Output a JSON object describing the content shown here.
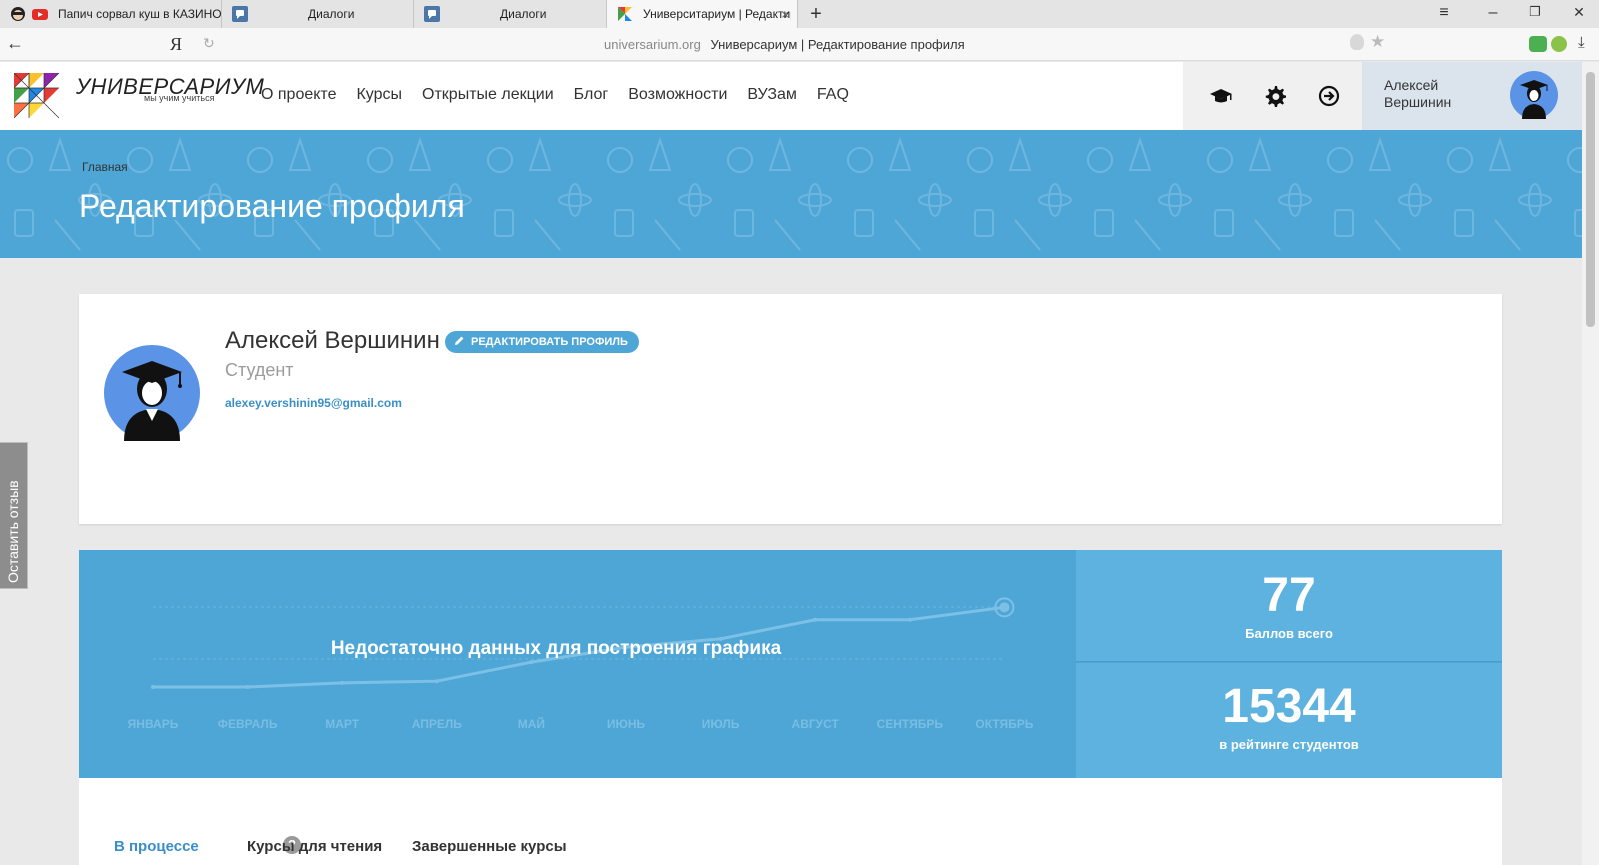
{
  "browser": {
    "tabs": [
      {
        "title": "Папич сорвал куш в КАЗИНО",
        "icon": "youtube-icon"
      },
      {
        "title": "Диалоги",
        "icon": "vk-dialogs-icon"
      },
      {
        "title": "Диалоги",
        "icon": "vk-dialogs-icon"
      },
      {
        "title": "Университариум | Редактирование профиля",
        "icon": "universarium-icon"
      }
    ],
    "tab_close": "×",
    "new_tab": "+",
    "window_controls": {
      "menu": "≡",
      "minimize": "–",
      "restore": "❐",
      "close": "✕"
    },
    "back": "←",
    "yandex": "Я",
    "reload": "↻",
    "address_domain": "universarium.org",
    "address_title": "Универсариум | Редактирование профиля",
    "star": "★",
    "download": "⤓"
  },
  "site": {
    "logo_text": "УНИВЕРСАРИУМ",
    "logo_tagline": "мы учим учиться",
    "nav": [
      "О проекте",
      "Курсы",
      "Открытые лекции",
      "Блог",
      "Возможности",
      "ВУЗам",
      "FAQ"
    ],
    "header_icons": [
      "graduation-cap-icon",
      "gear-icon",
      "logout-icon"
    ],
    "user_name": "Алексей Вершинин"
  },
  "banner": {
    "breadcrumb": "Главная",
    "title": "Редактирование профиля"
  },
  "profile": {
    "name": "Алексей Вершинин",
    "edit_button": "РЕДАКТИРОВАТЬ ПРОФИЛЬ",
    "role": "Студент",
    "email": "alexey.vershinin95@gmail.com"
  },
  "stats": {
    "message": "Недостаточно данных для построения графика",
    "points_value": "77",
    "points_label": "Баллов всего",
    "rank_value": "15344",
    "rank_label": "в рейтинге студентов"
  },
  "courses": {
    "tabs": [
      "В процессе",
      "Курсы для чтения",
      "Завершенные курсы"
    ],
    "help": "?"
  },
  "feedback": "Оставить отзыв",
  "chart_data": {
    "type": "line",
    "categories": [
      "ЯНВАРЬ",
      "ФЕВРАЛЬ",
      "МАРТ",
      "АПРЕЛЬ",
      "МАЙ",
      "ИЮНЬ",
      "ИЮЛЬ",
      "АВГУСТ",
      "СЕНТЯБРЬ",
      "ОКТЯБРЬ"
    ],
    "values": [
      0,
      0,
      5,
      7,
      30,
      48,
      58,
      81,
      81,
      96
    ],
    "ylim": [
      0,
      100
    ],
    "grid": true,
    "colors": {
      "line": "#7cc0e6",
      "label": "#79bde3",
      "grid": "#6fb6e0"
    }
  },
  "colors": {
    "accent": "#4ea6d6",
    "link": "#3a8fc7"
  }
}
